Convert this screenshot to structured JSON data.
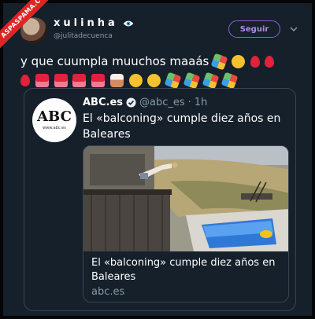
{
  "watermark": {
    "text": "ASPASPAMA.COM"
  },
  "tweet": {
    "display_name": "xulinha",
    "handle": "@julitadecuenca",
    "follow_label": "Seguir",
    "text": "y que cuumpla muuchos maaás",
    "emojis_line1": [
      "party-popper-icon",
      "clapping-hands-icon",
      "balloon-icon",
      "balloon-icon"
    ],
    "emojis_line2": [
      "balloon-icon",
      "gift-icon",
      "gift-icon",
      "gift-icon",
      "gift-icon",
      "birthday-cake-icon",
      "clapping-hands-icon",
      "clapping-hands-icon",
      "party-popper-icon",
      "party-popper-icon",
      "party-popper-icon",
      "party-popper-icon"
    ]
  },
  "quoted": {
    "logo_text": "ABC",
    "logo_url": "www.abc.es",
    "name": "ABC.es",
    "handle": "@abc_es",
    "separator": "·",
    "time": "1h",
    "text": "El «balconing» cumple diez años en Baleares",
    "card": {
      "title": "El «balconing» cumple diez años en Baleares",
      "domain": "abc.es"
    }
  },
  "colors": {
    "background": "#15202b",
    "accent": "#8b5fd6",
    "secondary_text": "#8899a6",
    "verified": "#1da1f2"
  }
}
